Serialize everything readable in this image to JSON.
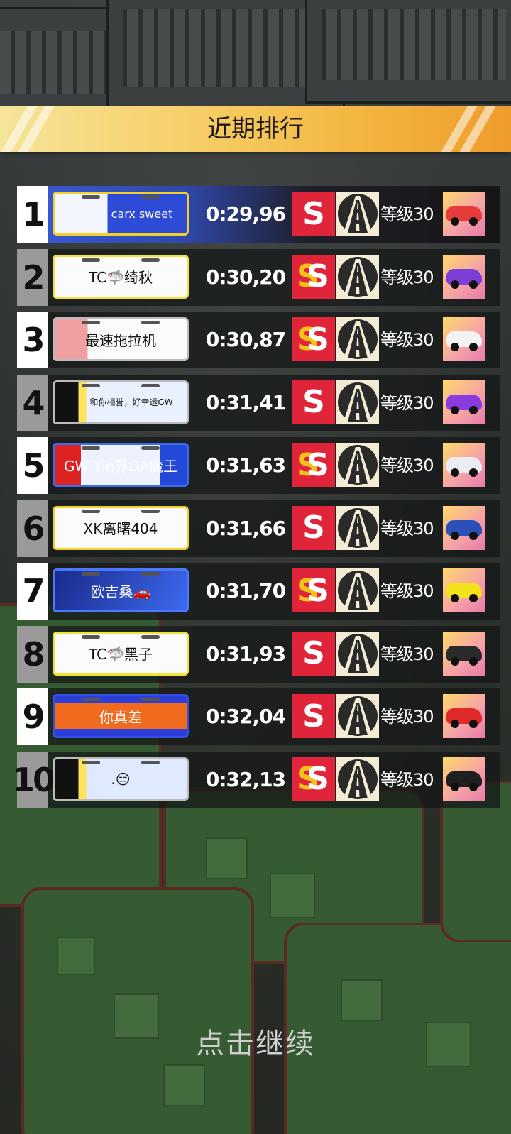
{
  "title": "近期排行",
  "continue_label": "点击继续",
  "level_label": "等级30",
  "badge_letter": "S",
  "colors": {
    "banner": "#f3b640",
    "s_badge": "#e0243a",
    "top_row": "#3b5bd8"
  },
  "rows": [
    {
      "rank": "1",
      "player": "carx sweet",
      "time": "0:29,96",
      "badge": "S",
      "car_color": "#e53b3b"
    },
    {
      "rank": "2",
      "player": "TC🦈绮秋",
      "time": "0:30,20",
      "badge": "SS",
      "car_color": "#7b3fd6"
    },
    {
      "rank": "3",
      "player": "最速拖拉机",
      "time": "0:30,87",
      "badge": "SS",
      "car_color": "#f2f2f2"
    },
    {
      "rank": "4",
      "player": "和你相誉，好幸运GW",
      "time": "0:31,41",
      "badge": "S",
      "car_color": "#8a3be0"
    },
    {
      "rank": "5",
      "player": "GW Yin界DA魔王",
      "time": "0:31,63",
      "badge": "SS",
      "car_color": "#ececf5"
    },
    {
      "rank": "6",
      "player": "XK离曙404",
      "time": "0:31,66",
      "badge": "S",
      "car_color": "#2c4fb8"
    },
    {
      "rank": "7",
      "player": "欧吉桑🚗",
      "time": "0:31,70",
      "badge": "SS",
      "car_color": "#f2e21a"
    },
    {
      "rank": "8",
      "player": "TC🦈黑子",
      "time": "0:31,93",
      "badge": "S",
      "car_color": "#2a2a2a"
    },
    {
      "rank": "9",
      "player": "你真差",
      "time": "0:32,04",
      "badge": "S",
      "car_color": "#e02a2a"
    },
    {
      "rank": "10",
      "player": ".😑",
      "time": "0:32,13",
      "badge": "SS",
      "car_color": "#1f1f1f"
    }
  ]
}
